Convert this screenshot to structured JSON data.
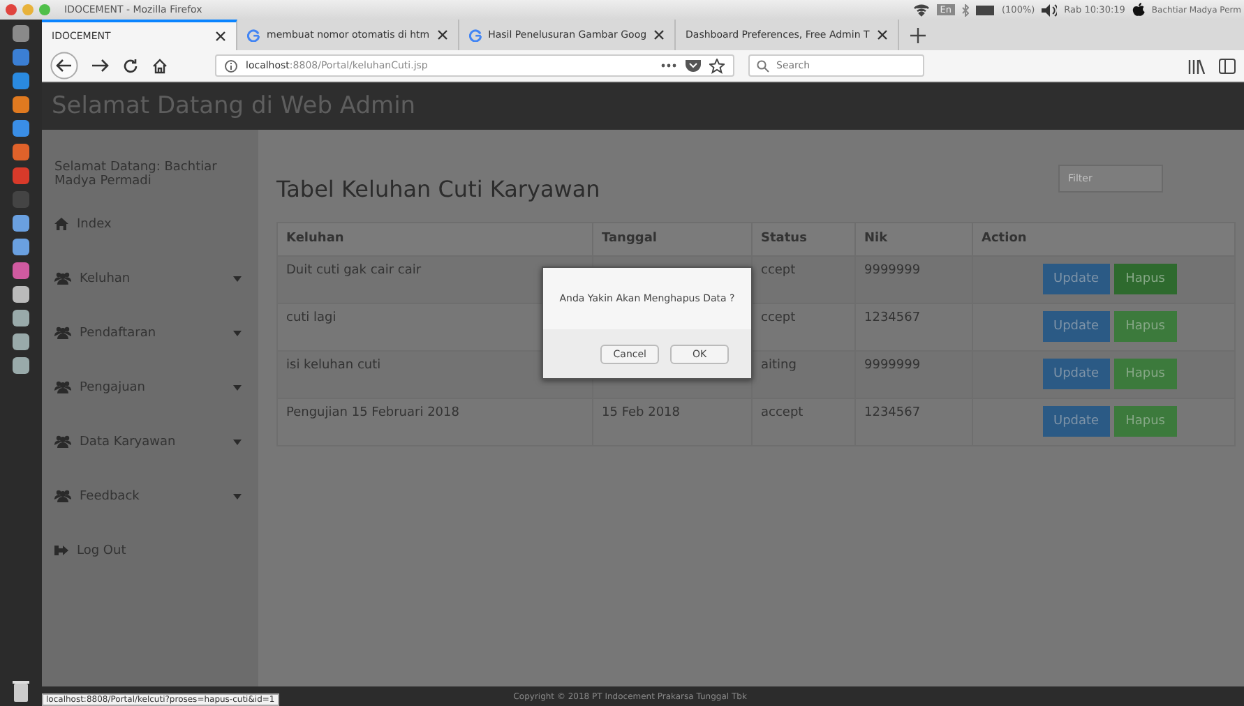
{
  "window": {
    "title": "IDOCEMENT - Mozilla Firefox"
  },
  "system_tray": {
    "keyboard": "En",
    "battery": "(100%)",
    "clock": "Rab 10:30:19",
    "user": "Bachtiar Madya Perm"
  },
  "tabs": [
    {
      "label": "IDOCEMENT",
      "selected": true,
      "kind": "page"
    },
    {
      "label": "membuat nomor otomatis di htm",
      "selected": false,
      "kind": "google"
    },
    {
      "label": "Hasil Penelusuran Gambar Goog",
      "selected": false,
      "kind": "google"
    },
    {
      "label": "Dashboard Preferences, Free Admin T",
      "selected": false,
      "kind": "page"
    }
  ],
  "address_bar": {
    "host": "localhost",
    "path": ":8808/Portal/keluhanCuti.jsp"
  },
  "search": {
    "placeholder": "Search"
  },
  "page": {
    "header": "Selamat Datang di Web Admin",
    "welcome": "Selamat Datang: Bachtiar Madya Permadi",
    "menu": [
      {
        "label": "Index",
        "kind": "home"
      },
      {
        "label": "Keluhan",
        "kind": "group"
      },
      {
        "label": "Pendaftaran",
        "kind": "group"
      },
      {
        "label": "Pengajuan",
        "kind": "group"
      },
      {
        "label": "Data Karyawan",
        "kind": "group"
      },
      {
        "label": "Feedback",
        "kind": "group"
      },
      {
        "label": "Log Out",
        "kind": "logout"
      }
    ],
    "title": "Tabel Keluhan Cuti Karyawan",
    "filter": {
      "placeholder": "Filter"
    },
    "table": {
      "columns": [
        "Keluhan",
        "Tanggal",
        "Status",
        "Nik",
        "Action"
      ],
      "rows": [
        {
          "keluhan": "Duit cuti gak cair cair",
          "status": "ccept",
          "nik": "9999999",
          "actions": [
            {
              "label": "Update",
              "kind": "update",
              "focused": false
            },
            {
              "label": "Hapus",
              "kind": "delete",
              "focused": true
            }
          ]
        },
        {
          "keluhan": "cuti lagi",
          "status": "ccept",
          "nik": "1234567",
          "actions": [
            {
              "label": "Update",
              "kind": "update",
              "focused": false
            },
            {
              "label": "Hapus",
              "kind": "delete",
              "focused": false
            }
          ]
        },
        {
          "keluhan": "isi keluhan cuti",
          "status": "aiting",
          "nik": "9999999",
          "actions": [
            {
              "label": "Update",
              "kind": "update",
              "focused": false
            },
            {
              "label": "Hapus",
              "kind": "delete",
              "focused": false
            }
          ]
        },
        {
          "keluhan": "Pengujian 15 Februari 2018",
          "tanggal": "15 Feb 2018",
          "status": "accept",
          "nik": "1234567",
          "actions": [
            {
              "label": "Update",
              "kind": "update",
              "focused": false
            },
            {
              "label": "Hapus",
              "kind": "delete",
              "focused": false
            }
          ]
        }
      ]
    },
    "footer": "Copyright © 2018 PT Indocement Prakarsa Tunggal Tbk"
  },
  "dialog": {
    "message": "Anda Yakin Akan Menghapus Data ?",
    "buttons": [
      "Cancel",
      "OK"
    ]
  },
  "status_url": "localhost:8808/Portal/kelcuti?proses=hapus-cuti&id=1"
}
